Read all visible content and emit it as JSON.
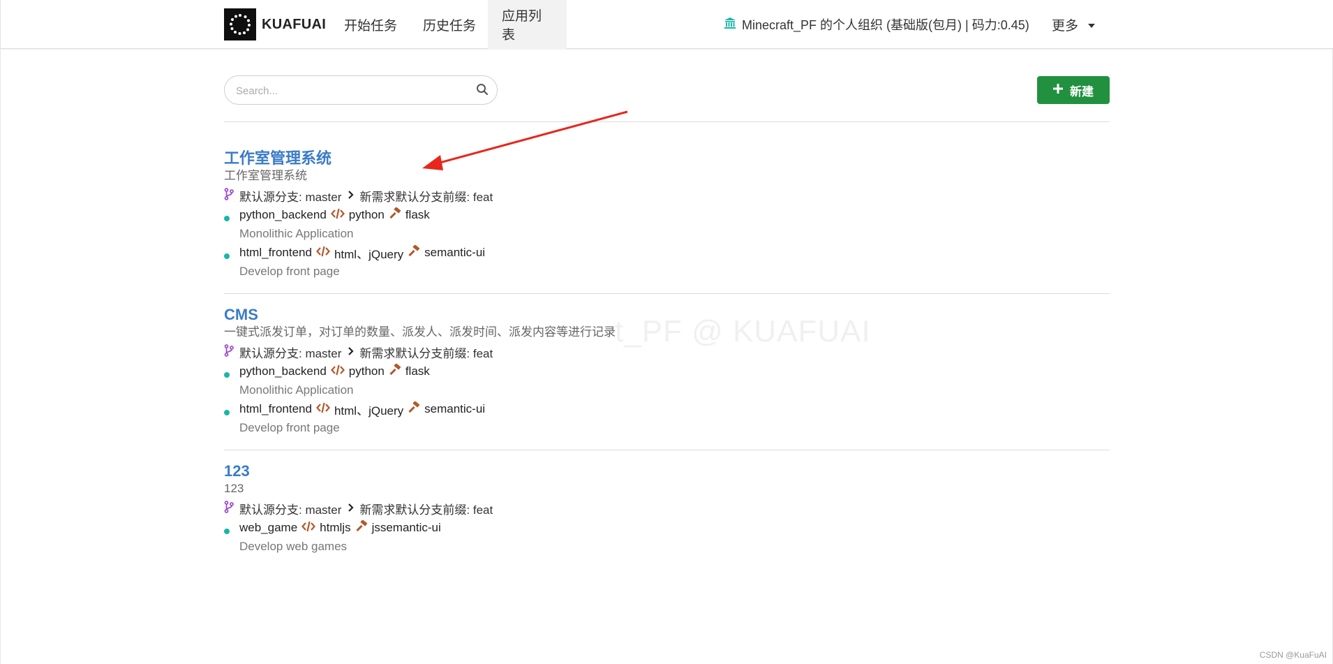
{
  "brand": {
    "name": "KUAFUAI"
  },
  "nav": {
    "items": [
      {
        "label": "开始任务"
      },
      {
        "label": "历史任务"
      },
      {
        "label": "应用列表"
      }
    ],
    "org_label": "Minecraft_PF 的个人组织 (基础版(包月) | 码力:0.45)",
    "more_label": "更多"
  },
  "search": {
    "placeholder": "Search..."
  },
  "new_button": {
    "label": "新建"
  },
  "apps": [
    {
      "title": "工作室管理系统",
      "description": "工作室管理系统",
      "branch_source": "默认源分支: master",
      "branch_prefix": "新需求默认分支前缀: feat",
      "services": [
        {
          "name": "python_backend",
          "lang": "python",
          "framework": "flask",
          "subtitle": "Monolithic Application"
        },
        {
          "name": "html_frontend",
          "lang": "html、jQuery",
          "framework": "semantic-ui",
          "subtitle": "Develop front page"
        }
      ]
    },
    {
      "title": "CMS",
      "description": "一键式派发订单，对订单的数量、派发人、派发时间、派发内容等进行记录",
      "branch_source": "默认源分支: master",
      "branch_prefix": "新需求默认分支前缀: feat",
      "services": [
        {
          "name": "python_backend",
          "lang": "python",
          "framework": "flask",
          "subtitle": "Monolithic Application"
        },
        {
          "name": "html_frontend",
          "lang": "html、jQuery",
          "framework": "semantic-ui",
          "subtitle": "Develop front page"
        }
      ]
    },
    {
      "title": "123",
      "description": "123",
      "branch_source": "默认源分支: master",
      "branch_prefix": "新需求默认分支前缀: feat",
      "services": [
        {
          "name": "web_game",
          "lang": "htmljs",
          "framework": "jssemantic-ui",
          "subtitle": "Develop web games"
        }
      ]
    }
  ],
  "watermark": "t_PF @ KUAFUAI",
  "footer_credit": "CSDN @KuaFuAI",
  "colors": {
    "link": "#3a7bc8",
    "primary_button": "#21913f",
    "dot": "#1ab5aa",
    "branch_icon": "#9b4fcf",
    "code_icon": "#b3582a",
    "annotation_arrow": "#e8261c"
  }
}
